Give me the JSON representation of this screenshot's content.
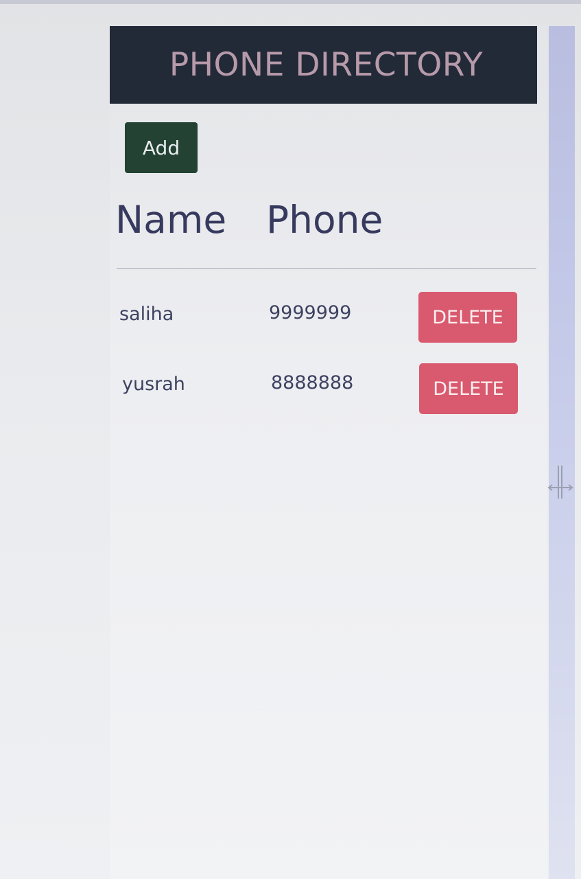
{
  "header": {
    "title": "PHONE DIRECTORY"
  },
  "toolbar": {
    "add_label": "Add"
  },
  "table": {
    "columns": [
      "Name",
      "Phone"
    ],
    "rows": [
      {
        "name": "saliha",
        "phone": "9999999",
        "action_label": "DELETE"
      },
      {
        "name": "yusrah",
        "phone": "8888888",
        "action_label": "DELETE"
      }
    ]
  },
  "colors": {
    "header_bg": "#222a38",
    "header_text": "#b79aaa",
    "add_button": "#234233",
    "delete_button": "#d95a6e"
  },
  "icons": {
    "cursor": "resize-horizontal-icon"
  }
}
